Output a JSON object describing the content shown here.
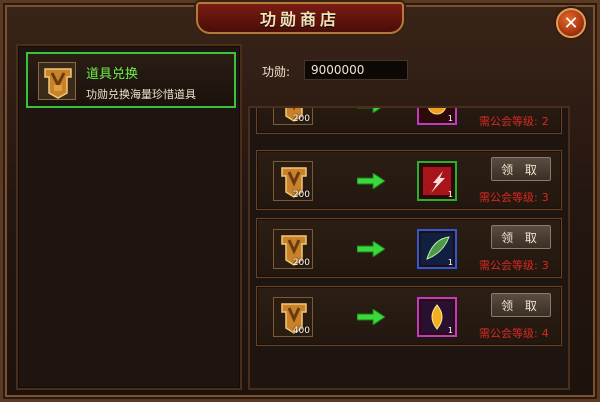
{
  "window": {
    "title": "功勋商店",
    "close_glyph": "✕"
  },
  "sidebar": {
    "items": [
      {
        "title": "道具兑换",
        "description": "功勋兑换海量珍惜道具",
        "icon": "medal-shield-icon",
        "selected": true
      }
    ]
  },
  "points": {
    "label": "功勋:",
    "value": "9000000"
  },
  "exchange": {
    "claim_label": "领 取",
    "requirement_label": "需公会等级:",
    "rows": [
      {
        "cost": "200",
        "reward_icon": "orange-orb-icon",
        "reward_count": "1",
        "reward_frame": "#c23ac2",
        "level": "2"
      },
      {
        "cost": "200",
        "reward_icon": "red-crystal-icon",
        "reward_count": "1",
        "reward_frame": "#2ab02a",
        "level": "3"
      },
      {
        "cost": "200",
        "reward_icon": "green-feather-icon",
        "reward_count": "1",
        "reward_frame": "#2a5ad8",
        "level": "3"
      },
      {
        "cost": "400",
        "reward_icon": "golden-leaf-icon",
        "reward_count": "1",
        "reward_frame": "#c23ac2",
        "level": "4"
      }
    ]
  },
  "colors": {
    "accent_green": "#6cf04c",
    "requirement_red": "#d82a22"
  }
}
